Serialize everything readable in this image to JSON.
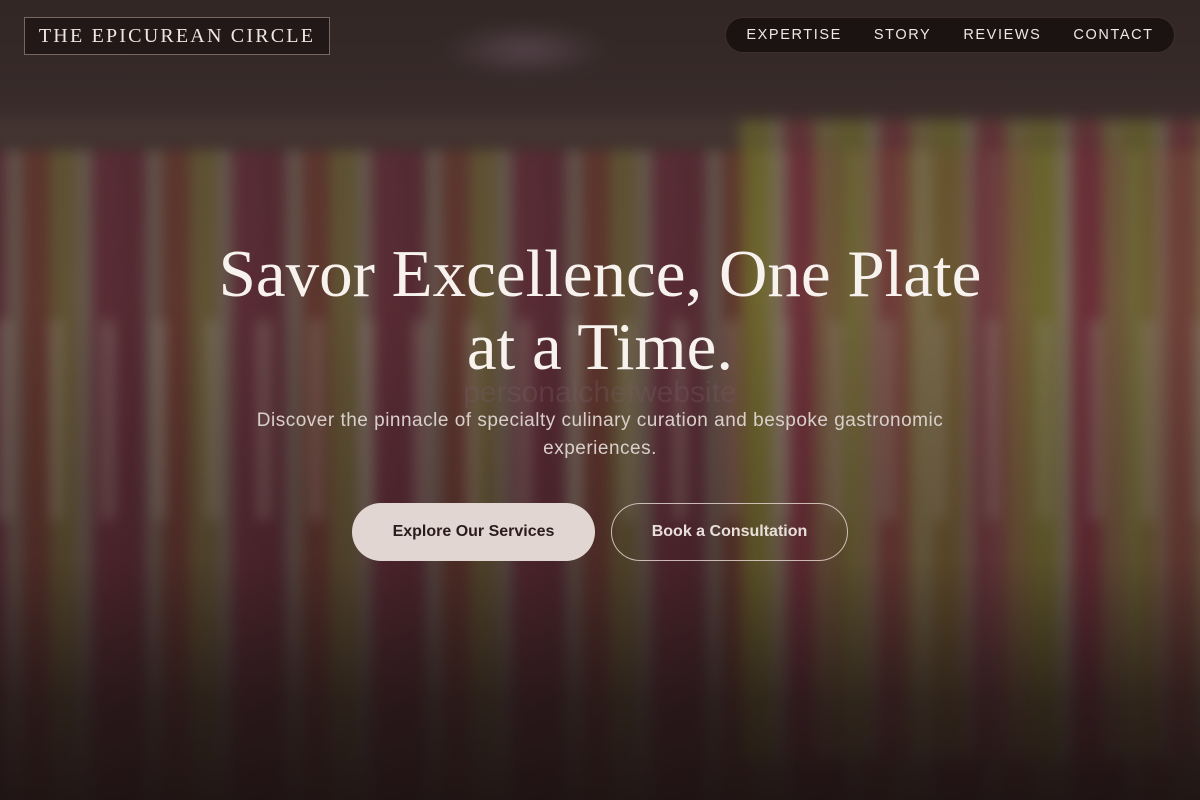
{
  "brand": {
    "name": "THE EPICUREAN CIRCLE"
  },
  "nav": {
    "items": [
      {
        "label": "EXPERTISE"
      },
      {
        "label": "STORY"
      },
      {
        "label": "REVIEWS"
      },
      {
        "label": "CONTACT"
      }
    ]
  },
  "hero": {
    "headline_line1": "Savor Excellence, One Plate",
    "headline_line2": "at a Time.",
    "watermark": "personalchefwebsite",
    "subtitle": "Discover the pinnacle of specialty culinary curation and bespoke gastronomic experiences.",
    "primary_cta": "Explore Our Services",
    "secondary_cta": "Book a Consultation"
  },
  "colors": {
    "accent_button": "#e2d6d2",
    "text_light": "#f7f2ee",
    "background_dark": "#1e1414"
  }
}
